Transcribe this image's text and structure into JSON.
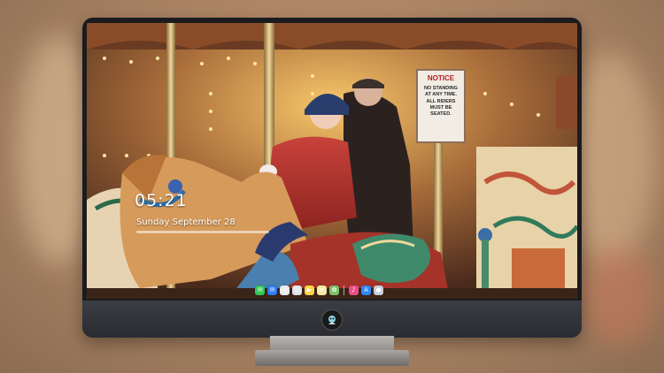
{
  "lockscreen": {
    "time": "05:21",
    "date": "Sunday September  28"
  },
  "notice_sign": {
    "title": "NOTICE",
    "line1": "NO STANDING",
    "line2": "AT ANY TIME.",
    "line3": "ALL RIDERS",
    "line4": "MUST BE",
    "line5": "SEATED."
  },
  "dock": {
    "icons": [
      {
        "name": "messages-icon",
        "color": "#34c759",
        "glyph": "✉"
      },
      {
        "name": "mail-icon",
        "color": "#2f7cf6",
        "glyph": "✉"
      },
      {
        "name": "safari-icon",
        "color": "#e9e9ee",
        "glyph": "◎"
      },
      {
        "name": "finder-icon",
        "color": "#dfe3e8",
        "glyph": "☺"
      },
      {
        "name": "video-icon",
        "color": "#ffd24a",
        "glyph": "▶"
      },
      {
        "name": "notes-icon",
        "color": "#f5e9a6",
        "glyph": "≡"
      },
      {
        "name": "photos-icon",
        "color": "#7cc26b",
        "glyph": "✿"
      },
      {
        "name": "music-icon",
        "color": "#e94f86",
        "glyph": "♪"
      },
      {
        "name": "appstore-icon",
        "color": "#2f87f6",
        "glyph": "A"
      },
      {
        "name": "camera-icon",
        "color": "#c9ced6",
        "glyph": "●"
      }
    ]
  }
}
